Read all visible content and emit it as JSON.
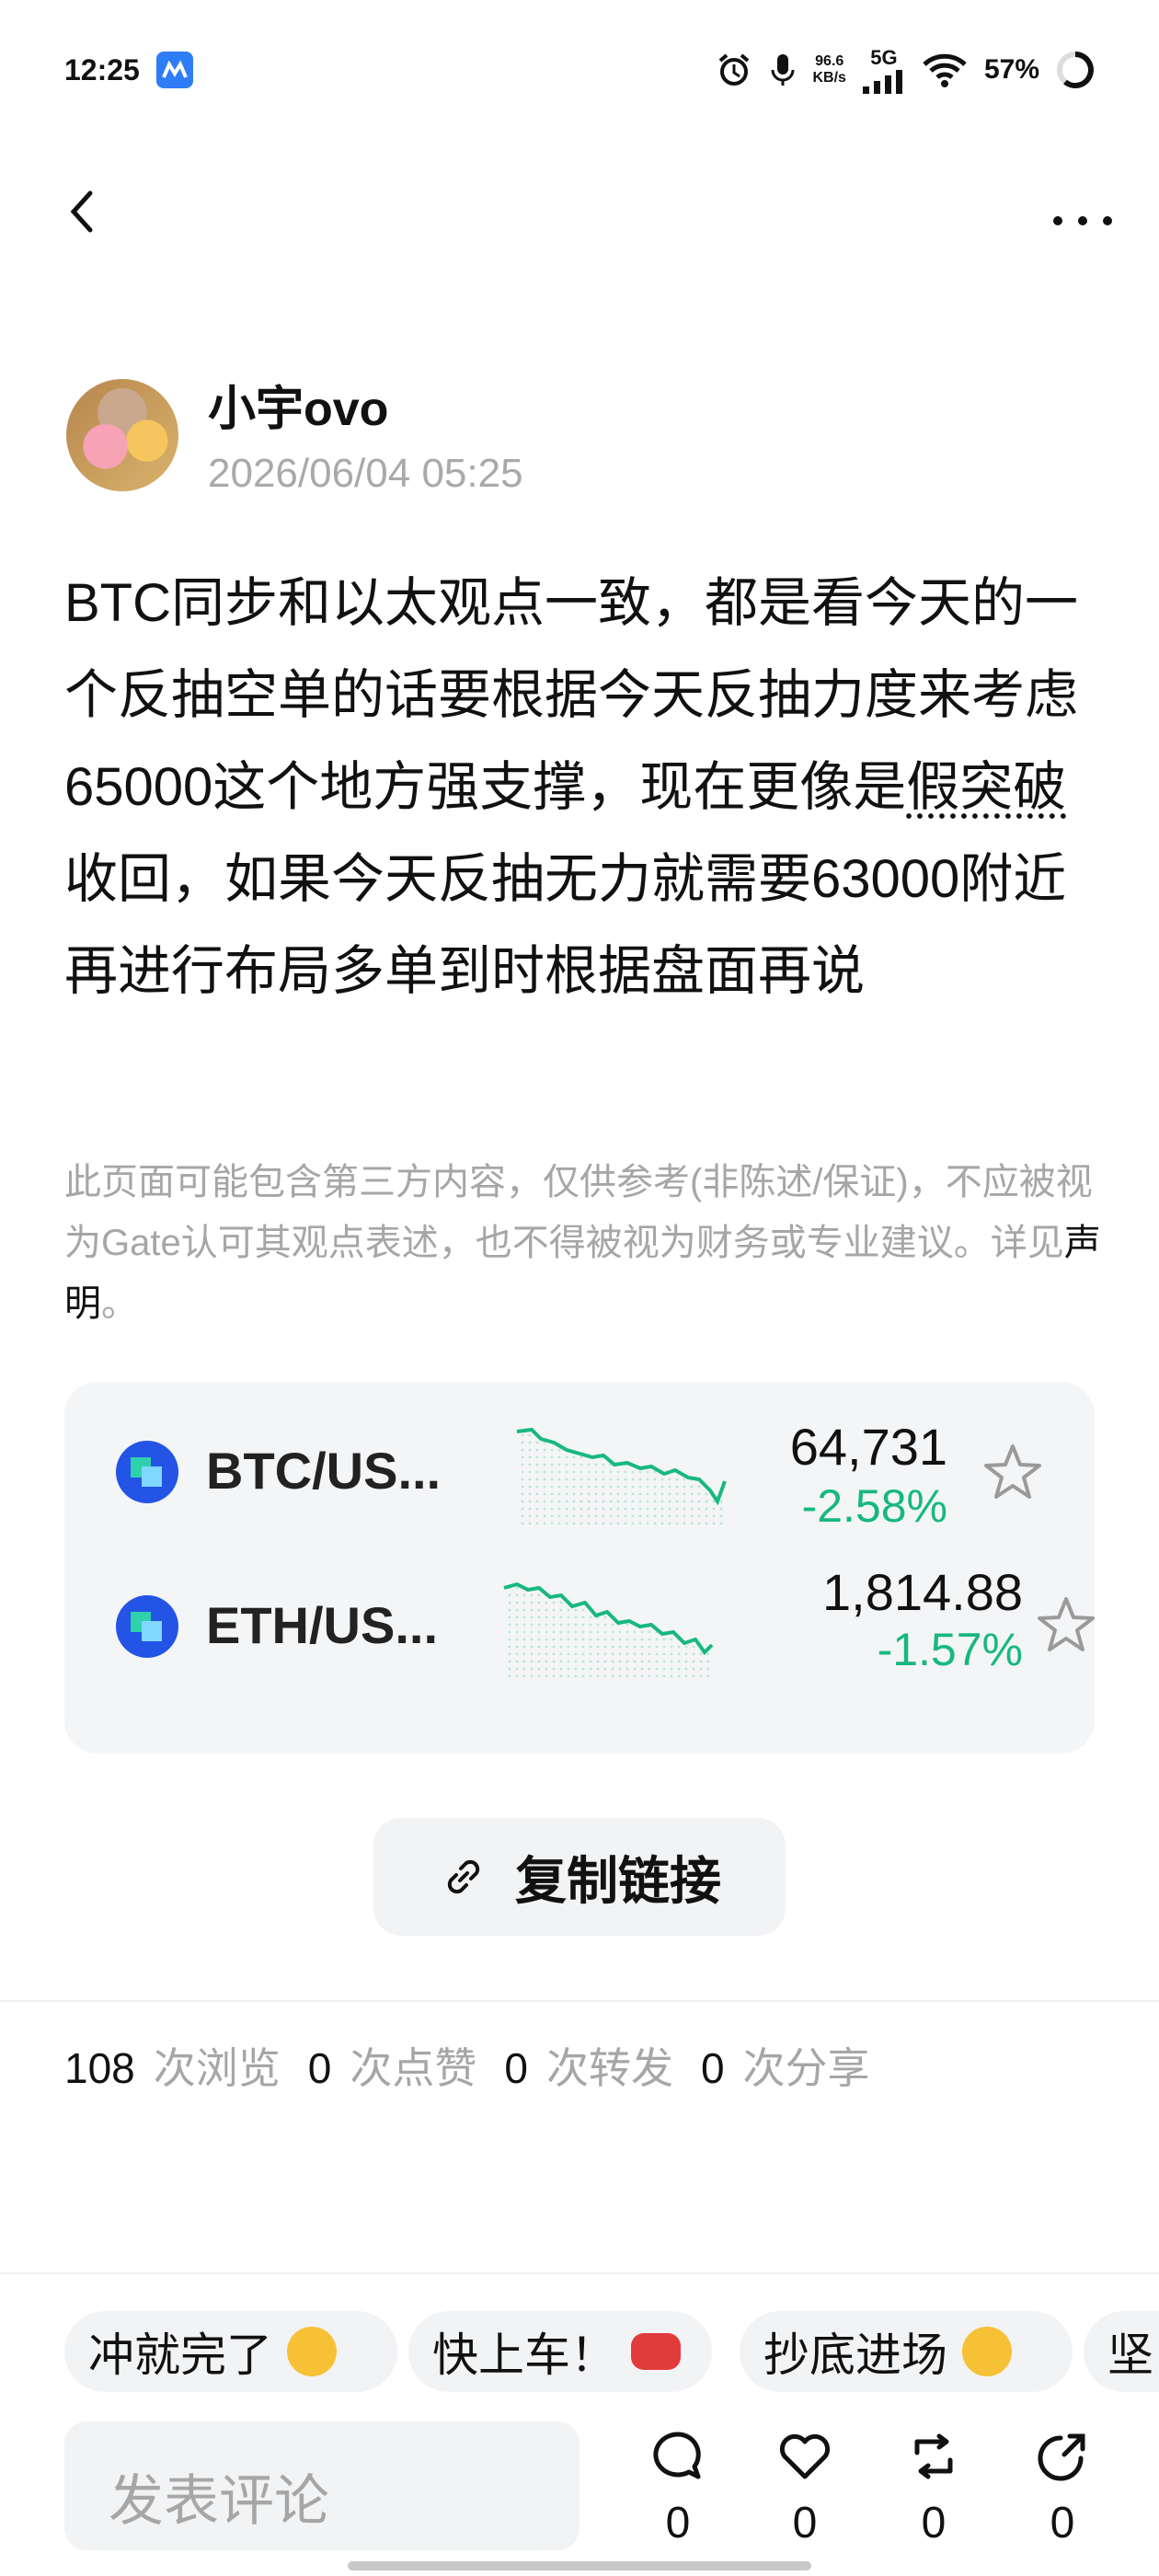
{
  "status_bar": {
    "time": "12:25",
    "speed_value": "96.6",
    "speed_unit": "KB/s",
    "network": "5G",
    "battery": "57%"
  },
  "post": {
    "author": "小宇ovo",
    "timestamp": "2026/06/04 05:25",
    "text_part1": "BTC同步和以太观点一致，都是看今天的一个反抽空单的话要根据今天反抽力度来考虑 65000这个地方强支撑，现在更像是",
    "text_underlined": "假突破",
    "text_part2": "收回，如果今天反抽无力就需要63000附近再进行布局多单到时根据盘面再说",
    "disclaimer": "此页面可能包含第三方内容，仅供参考(非陈述/保证)，不应被视为Gate认可其观点表述，也不得被视为财务或专业建议。详见",
    "disclaimer_link": "声明",
    "disclaimer_end": "。"
  },
  "markets": [
    {
      "pair": "BTC/US...",
      "price": "64,731",
      "change": "-2.58%",
      "color": "#17b87f"
    },
    {
      "pair": "ETH/US...",
      "price": "1,814.88",
      "change": "-1.57%",
      "color": "#17b87f"
    }
  ],
  "copy_link_label": "复制链接",
  "stats": {
    "views": "108",
    "views_label": "次浏览",
    "likes": "0",
    "likes_label": "次点赞",
    "reposts": "0",
    "reposts_label": "次转发",
    "shares": "0",
    "shares_label": "次分享"
  },
  "reactions": [
    {
      "label": "冲就完了",
      "icon": "fist-emoji"
    },
    {
      "label": "快上车！",
      "icon": "car-emoji"
    },
    {
      "label": "抄底进场",
      "icon": "sunglasses-emoji"
    },
    {
      "label": "坚"
    }
  ],
  "comment_placeholder": "发表评论",
  "actions": {
    "comment_count": "0",
    "like_count": "0",
    "repost_count": "0",
    "share_count": "0"
  }
}
